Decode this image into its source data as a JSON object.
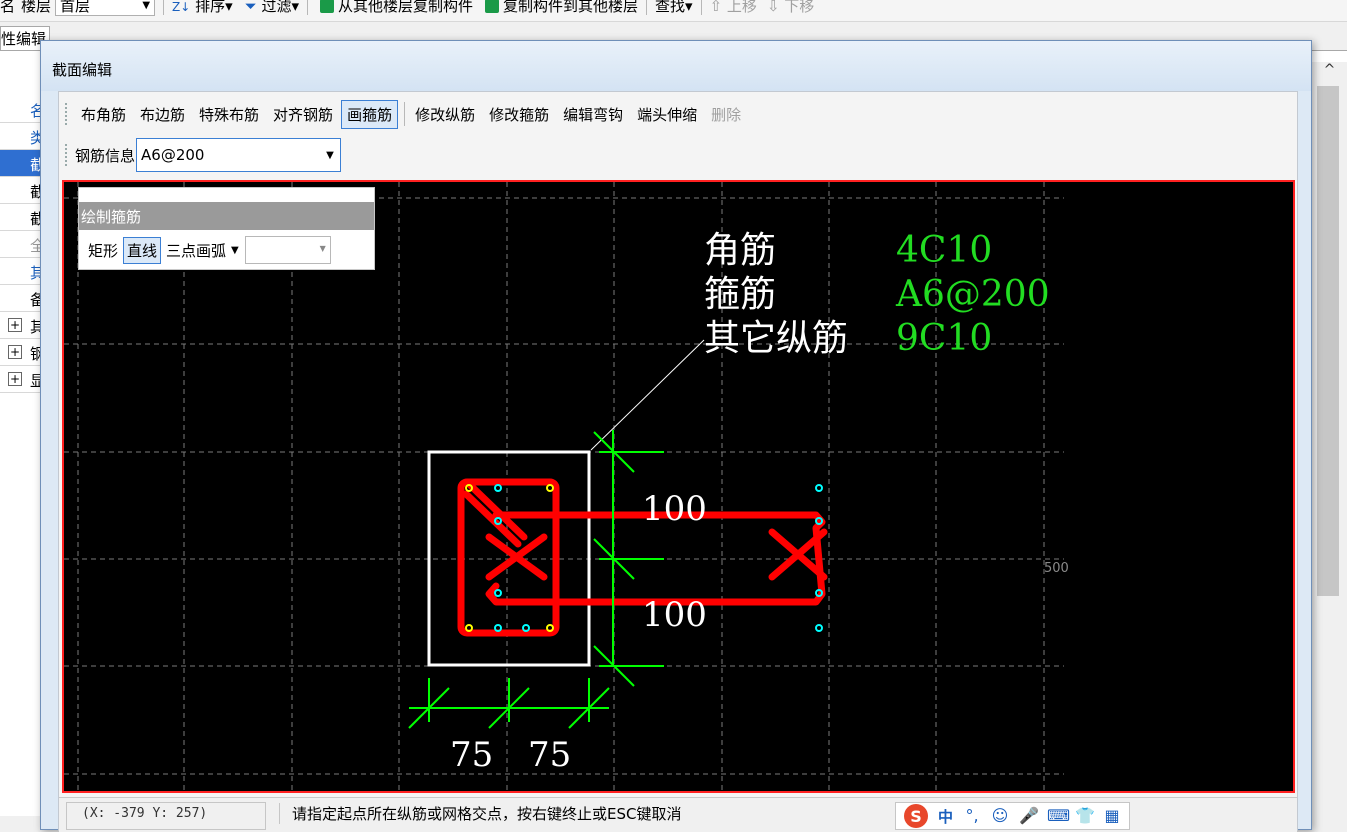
{
  "topbar": {
    "name_label": "名",
    "floor_label": "楼层",
    "floor_value": "首层",
    "sort_label": "排序",
    "filter_label": "过滤",
    "copy_from_label": "从其他楼层复制构件",
    "copy_to_label": "复制构件到其他楼层",
    "find_label": "查找",
    "move_up_label": "上移",
    "move_down_label": "下移"
  },
  "bg": {
    "tab_label": "性编辑",
    "rows": [
      "名",
      "类",
      "截",
      "截",
      "截",
      "全",
      "其",
      "备"
    ],
    "groups": [
      "其",
      "钢",
      "显"
    ]
  },
  "dialog": {
    "title": "截面编辑",
    "toolbar": {
      "buttons": [
        "布角筋",
        "布边筋",
        "特殊布筋",
        "对齐钢筋",
        "画箍筋",
        "修改纵筋",
        "修改箍筋",
        "编辑弯钩",
        "端头伸缩",
        "删除"
      ],
      "rebar_info_label": "钢筋信息",
      "rebar_info_value": "A6@200"
    },
    "palette": {
      "title": "绘制箍筋",
      "buttons": [
        "矩形",
        "直线",
        "三点画弧"
      ],
      "combo_value": ""
    },
    "canvas": {
      "labels": [
        {
          "name": "角筋",
          "value": "4C10"
        },
        {
          "name": "箍筋",
          "value": "A6@200"
        },
        {
          "name": "其它纵筋",
          "value": "9C10"
        }
      ],
      "dim_vertical": [
        "100",
        "100"
      ],
      "dim_horizontal": [
        "75",
        "75"
      ],
      "grid_label": "500",
      "colors": {
        "background": "#000000",
        "rebar": "#ff0000",
        "dimension": "#00ff00",
        "outline": "#ffffff",
        "corner_bar": "#ffff00",
        "side_bar": "#00ffff"
      }
    },
    "status": {
      "coord": "(X: -379 Y: 257)",
      "message": "请指定起点所在纵筋或网格交点，按右键终止或ESC键取消",
      "ime_zh": "中"
    }
  }
}
